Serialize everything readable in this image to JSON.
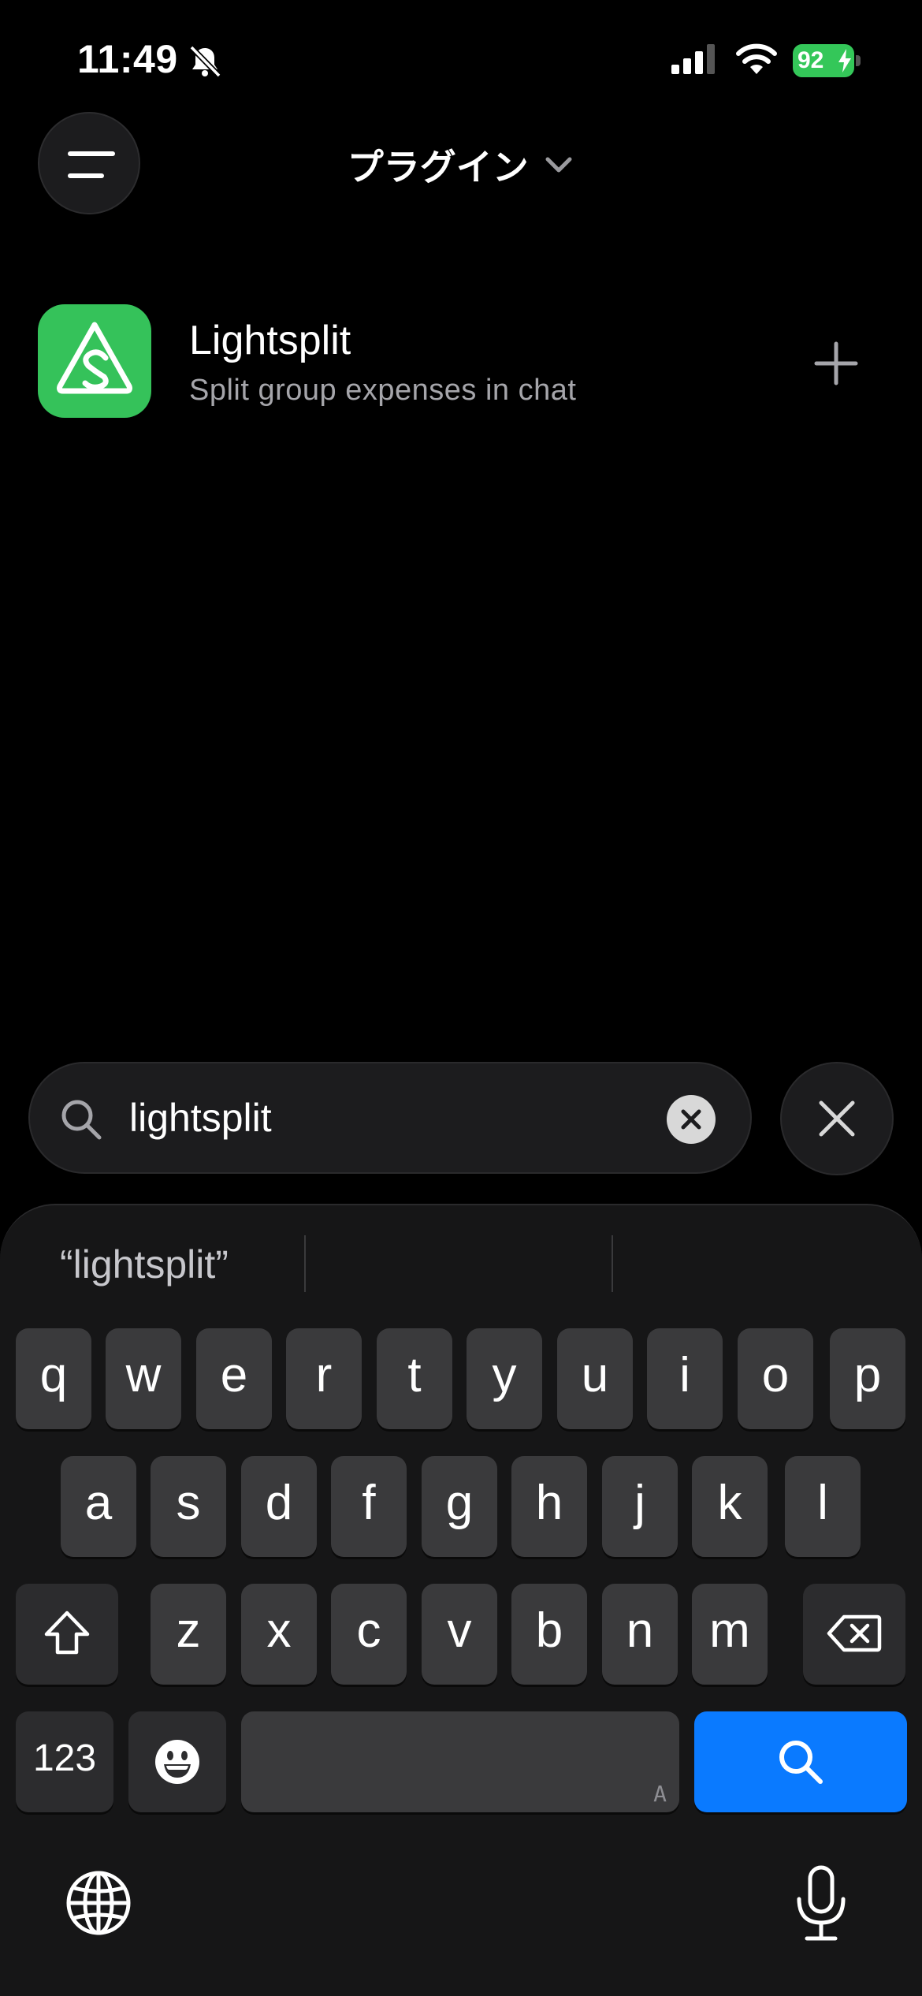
{
  "status_bar": {
    "time": "11:49",
    "battery_level": "92",
    "battery_color": "#34c759"
  },
  "header": {
    "title": "プラグイン",
    "menu_icon": "menu-icon",
    "chevron_icon": "chevron-down-icon"
  },
  "plugin": {
    "name": "Lightsplit",
    "description": "Split group expenses in chat",
    "icon_color": "#35c25a",
    "add_icon": "plus-icon"
  },
  "search": {
    "query": "lightsplit",
    "clear_icon": "clear-icon",
    "close_icon": "close-icon"
  },
  "keyboard": {
    "suggestion": "“lightsplit”",
    "row1": [
      "q",
      "w",
      "e",
      "r",
      "t",
      "y",
      "u",
      "i",
      "o",
      "p"
    ],
    "row2": [
      "a",
      "s",
      "d",
      "f",
      "g",
      "h",
      "j",
      "k",
      "l"
    ],
    "row3": [
      "z",
      "x",
      "c",
      "v",
      "b",
      "n",
      "m"
    ],
    "numbers_label": "123",
    "space_hint": "A",
    "search_key_color": "#0a7aff"
  }
}
